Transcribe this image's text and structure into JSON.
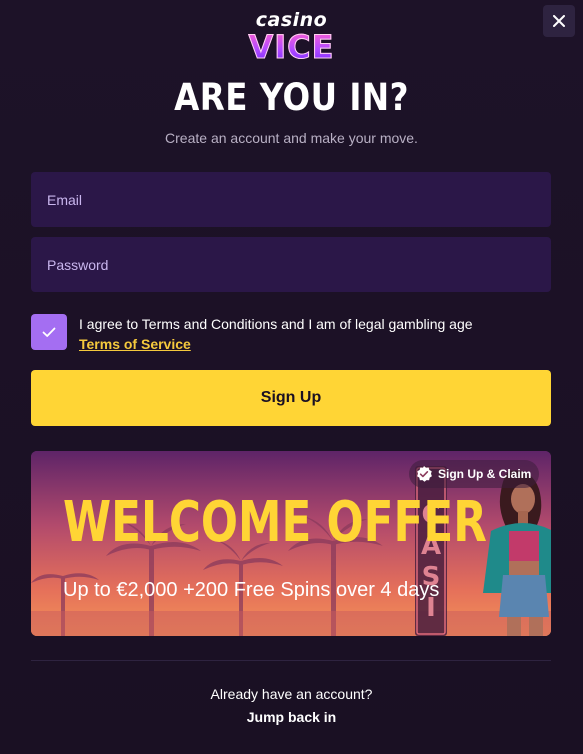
{
  "logo": {
    "line1": "casino",
    "line2": "VICE"
  },
  "title": "ARE YOU IN?",
  "subtitle": "Create an account and make your move.",
  "form": {
    "email_placeholder": "Email",
    "password_placeholder": "Password",
    "agree_text": "I agree to Terms and Conditions and I am of legal gambling age",
    "tos_link": "Terms of Service",
    "checkbox_checked": true,
    "signup_label": "Sign Up"
  },
  "banner": {
    "badge": "Sign Up & Claim",
    "title": "WELCOME OFFER",
    "subtitle": "Up to €2,000 +200 Free Spins over 4 days",
    "sign_text": "CASI"
  },
  "footer": {
    "prompt": "Already have an account?",
    "link": "Jump back in"
  },
  "colors": {
    "background": "#1b1125",
    "field": "#2b1748",
    "checkbox": "#a46ef2",
    "accent_yellow": "#ffd535",
    "link_yellow": "#f5c93d"
  },
  "icons": [
    "close-icon",
    "checkmark-icon",
    "verified-badge-icon"
  ]
}
